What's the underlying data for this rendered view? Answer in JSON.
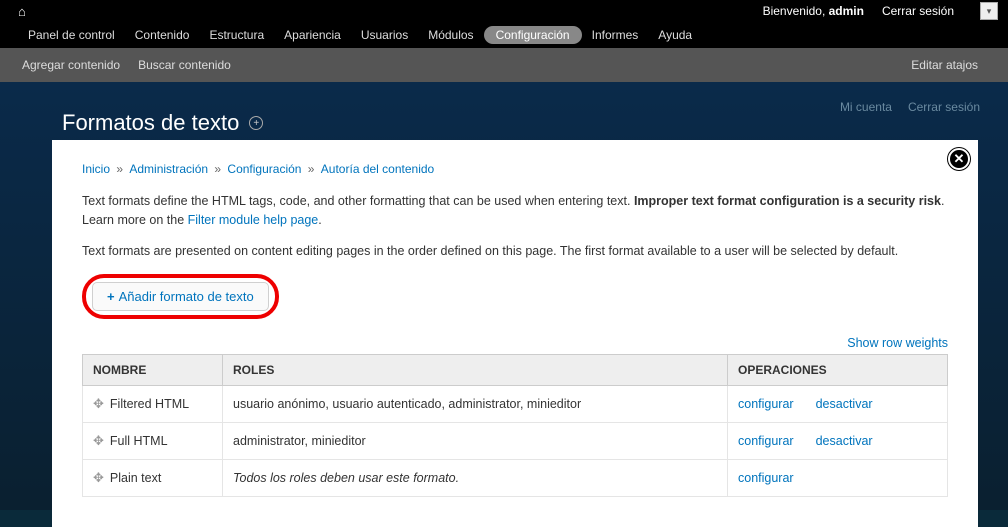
{
  "topbar": {
    "welcome_prefix": "Bienvenido, ",
    "welcome_user": "admin",
    "logout": "Cerrar sesión",
    "menu": [
      "Panel de control",
      "Contenido",
      "Estructura",
      "Apariencia",
      "Usuarios",
      "Módulos",
      "Configuración",
      "Informes",
      "Ayuda"
    ],
    "active_index": 6
  },
  "shortcuts": {
    "add_content": "Agregar contenido",
    "find_content": "Buscar contenido",
    "edit_shortcuts": "Editar atajos"
  },
  "account": {
    "my_account": "Mi cuenta",
    "logout": "Cerrar sesión"
  },
  "page": {
    "title": "Formatos de texto"
  },
  "breadcrumb": {
    "items": [
      "Inicio",
      "Administración",
      "Configuración",
      "Autoría del contenido"
    ]
  },
  "body": {
    "p1a": "Text formats define the HTML tags, code, and other formatting that can be used when entering text. ",
    "p1b": "Improper text format configuration is a security risk",
    "p1c": ". Learn more on the ",
    "p1link": "Filter module help page",
    "p1d": ".",
    "p2": "Text formats are presented on content editing pages in the order defined on this page. The first format available to a user will be selected by default."
  },
  "add_button": "Añadir formato de texto",
  "show_weights": "Show row weights",
  "table": {
    "headers": {
      "name": "NOMBRE",
      "roles": "ROLES",
      "ops": "OPERACIONES"
    },
    "rows": [
      {
        "name": "Filtered HTML",
        "roles": "usuario anónimo, usuario autenticado, administrator, minieditor",
        "italic": false,
        "ops": [
          "configurar",
          "desactivar"
        ]
      },
      {
        "name": "Full HTML",
        "roles": "administrator, minieditor",
        "italic": false,
        "ops": [
          "configurar",
          "desactivar"
        ]
      },
      {
        "name": "Plain text",
        "roles": "Todos los roles deben usar este formato.",
        "italic": true,
        "ops": [
          "configurar"
        ]
      }
    ]
  }
}
